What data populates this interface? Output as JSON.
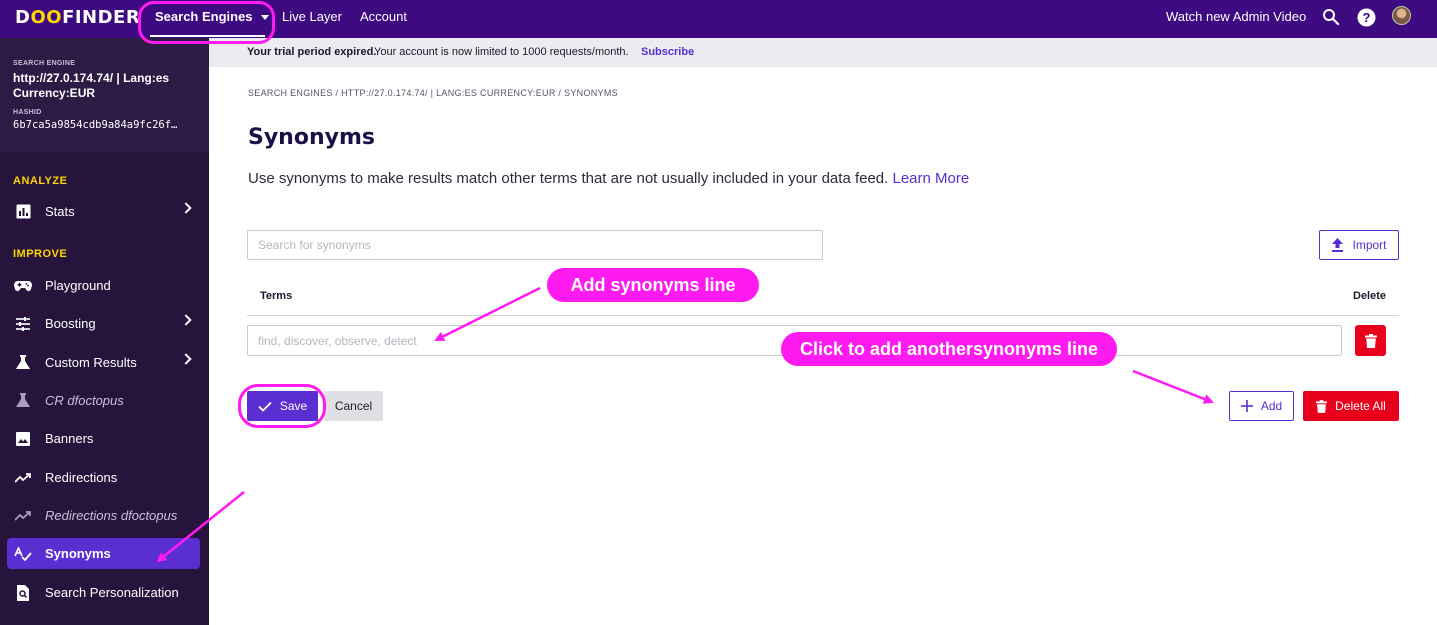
{
  "topbar": {
    "logo_left": "D",
    "logo_oo": "OO",
    "logo_right": "FINDER",
    "nav": {
      "search_engines": "Search Engines",
      "live_layer": "Live Layer",
      "account": "Account"
    },
    "watch_video": "Watch new Admin Video",
    "icons": [
      "search-icon",
      "help-icon",
      "avatar"
    ]
  },
  "sidebar": {
    "search_engine_label": "SEARCH ENGINE",
    "search_engine_name": "http://27.0.174.74/ | Lang:es Currency:EUR",
    "hashid_label": "HASHID",
    "hashid": "6b7ca5a9854cdb9a84a9fc26f…",
    "sections": {
      "analyze": "ANALYZE",
      "improve": "IMPROVE"
    },
    "items": [
      {
        "label": "Stats",
        "icon": "stats-icon"
      },
      {
        "label": "Playground",
        "icon": "gamepad-icon"
      },
      {
        "label": "Boosting",
        "icon": "sliders-icon"
      },
      {
        "label": "Custom Results",
        "icon": "flask-icon"
      },
      {
        "label": "CR dfoctopus",
        "icon": "flask-icon"
      },
      {
        "label": "Banners",
        "icon": "image-icon"
      },
      {
        "label": "Redirections",
        "icon": "trending-icon"
      },
      {
        "label": "Redirections dfoctopus",
        "icon": "trending-icon"
      },
      {
        "label": "Synonyms",
        "icon": "spellcheck-icon"
      },
      {
        "label": "Search Personalization",
        "icon": "personalization-icon"
      }
    ]
  },
  "banner": {
    "bold": "Your trial period expired.",
    "text": "Your account is now limited to 1000 requests/month.",
    "link": "Subscribe",
    "end": "."
  },
  "main": {
    "breadcrumb": "SEARCH ENGINES / HTTP://27.0.174.74/ | LANG:ES CURRENCY:EUR / SYNONYMS",
    "title": "Synonyms",
    "description": "Use synonyms to make results match other terms that are not usually included in your data feed.",
    "learn_more": "Learn More",
    "search_placeholder": "Search for synonyms",
    "import_label": "Import",
    "col_terms": "Terms",
    "col_delete": "Delete",
    "term_placeholder": "find, discover, observe, detect",
    "save_label": "Save",
    "cancel_label": "Cancel",
    "add_label": "Add",
    "delete_all_label": "Delete All"
  },
  "annotations": {
    "add_line": "Add synonyms line",
    "add_another": "Click to add anothersynonyms line"
  },
  "colors": {
    "topbar": "#3d0a82",
    "sidebar": "#26143d",
    "accent": "#5a2ed0",
    "danger": "#e8001c",
    "highlight": "#ff1bf0",
    "yellow": "#ffd600"
  }
}
